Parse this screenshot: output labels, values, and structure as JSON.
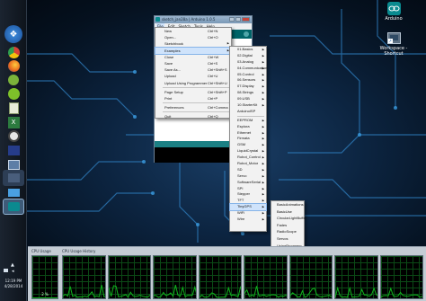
{
  "arduino_window": {
    "title": "sketch_jan28a | Arduino 1.0.5",
    "menubar": [
      "File",
      "Edit",
      "Sketch",
      "Tools",
      "Help"
    ]
  },
  "file_menu": {
    "items": [
      {
        "label": "New",
        "shortcut": "Ctrl+N"
      },
      {
        "label": "Open...",
        "shortcut": "Ctrl+O"
      },
      {
        "label": "Sketchbook",
        "shortcut": "",
        "submenu": true
      },
      {
        "label": "Examples",
        "shortcut": "",
        "submenu": true,
        "highlighted": true
      },
      {
        "label": "Close",
        "shortcut": "Ctrl+W"
      },
      {
        "label": "Save",
        "shortcut": "Ctrl+S"
      },
      {
        "label": "Save As...",
        "shortcut": "Ctrl+Shift+S"
      },
      {
        "label": "Upload",
        "shortcut": "Ctrl+U"
      },
      {
        "label": "Upload Using Programmer",
        "shortcut": "Ctrl+Shift+U"
      },
      {
        "label": "Page Setup",
        "shortcut": "Ctrl+Shift+P"
      },
      {
        "label": "Print",
        "shortcut": "Ctrl+P"
      },
      {
        "label": "Preferences",
        "shortcut": "Ctrl+Comma"
      },
      {
        "label": "Quit",
        "shortcut": "Ctrl+Q"
      }
    ]
  },
  "examples_menu": {
    "items": [
      "01.Basics",
      "02.Digital",
      "03.Analog",
      "04.Communication",
      "05.Control",
      "06.Sensors",
      "07.Display",
      "08.Strings",
      "09.USB",
      "10.StarterKit",
      "ArduinoISP",
      "EEPROM",
      "Esplora",
      "Ethernet",
      "Firmata",
      "GSM",
      "LiquidCrystal",
      "Robot_Control",
      "Robot_Motor",
      "SD",
      "Servo",
      "SoftwareSerial",
      "SPI",
      "Stepper",
      "TFT",
      "TinyGPS",
      "WiFi",
      "Wire"
    ],
    "highlighted": "TinyGPS"
  },
  "library_examples_menu": {
    "items": [
      "BasicAnimations",
      "BasicUse",
      "CircularLightBuffer",
      "Fades",
      "RadioScope",
      "Servos",
      "UsingProgmem"
    ]
  },
  "desktop": {
    "icons": [
      {
        "label": "Arduino"
      },
      {
        "label": "Workspace - Shortcut"
      }
    ]
  },
  "taskbar": {
    "time": "12:19 PM",
    "date": "4/28/2014"
  },
  "cpu_gadget": {
    "usage_label": "CPU Usage",
    "history_label": "CPU Usage History",
    "usage_percent": "2 %",
    "usage_value": 0.02,
    "core_count": 8
  },
  "colors": {
    "arduino_teal": "#006468",
    "graph_green": "#10b21d"
  }
}
